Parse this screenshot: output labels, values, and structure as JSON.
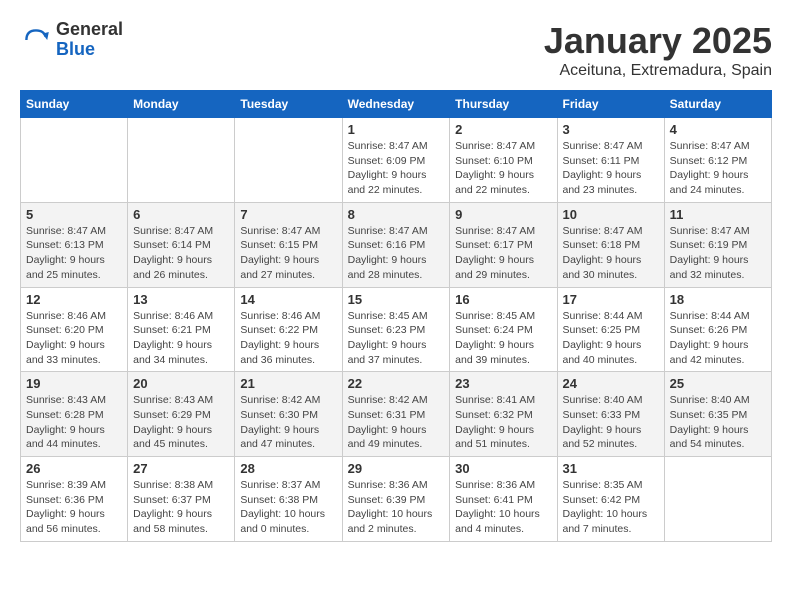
{
  "logo": {
    "general": "General",
    "blue": "Blue"
  },
  "title": {
    "month": "January 2025",
    "location": "Aceituna, Extremadura, Spain"
  },
  "weekdays": [
    "Sunday",
    "Monday",
    "Tuesday",
    "Wednesday",
    "Thursday",
    "Friday",
    "Saturday"
  ],
  "weeks": [
    [
      {
        "day": "",
        "sunrise": "",
        "sunset": "",
        "daylight": ""
      },
      {
        "day": "",
        "sunrise": "",
        "sunset": "",
        "daylight": ""
      },
      {
        "day": "",
        "sunrise": "",
        "sunset": "",
        "daylight": ""
      },
      {
        "day": "1",
        "sunrise": "Sunrise: 8:47 AM",
        "sunset": "Sunset: 6:09 PM",
        "daylight": "Daylight: 9 hours and 22 minutes."
      },
      {
        "day": "2",
        "sunrise": "Sunrise: 8:47 AM",
        "sunset": "Sunset: 6:10 PM",
        "daylight": "Daylight: 9 hours and 22 minutes."
      },
      {
        "day": "3",
        "sunrise": "Sunrise: 8:47 AM",
        "sunset": "Sunset: 6:11 PM",
        "daylight": "Daylight: 9 hours and 23 minutes."
      },
      {
        "day": "4",
        "sunrise": "Sunrise: 8:47 AM",
        "sunset": "Sunset: 6:12 PM",
        "daylight": "Daylight: 9 hours and 24 minutes."
      }
    ],
    [
      {
        "day": "5",
        "sunrise": "Sunrise: 8:47 AM",
        "sunset": "Sunset: 6:13 PM",
        "daylight": "Daylight: 9 hours and 25 minutes."
      },
      {
        "day": "6",
        "sunrise": "Sunrise: 8:47 AM",
        "sunset": "Sunset: 6:14 PM",
        "daylight": "Daylight: 9 hours and 26 minutes."
      },
      {
        "day": "7",
        "sunrise": "Sunrise: 8:47 AM",
        "sunset": "Sunset: 6:15 PM",
        "daylight": "Daylight: 9 hours and 27 minutes."
      },
      {
        "day": "8",
        "sunrise": "Sunrise: 8:47 AM",
        "sunset": "Sunset: 6:16 PM",
        "daylight": "Daylight: 9 hours and 28 minutes."
      },
      {
        "day": "9",
        "sunrise": "Sunrise: 8:47 AM",
        "sunset": "Sunset: 6:17 PM",
        "daylight": "Daylight: 9 hours and 29 minutes."
      },
      {
        "day": "10",
        "sunrise": "Sunrise: 8:47 AM",
        "sunset": "Sunset: 6:18 PM",
        "daylight": "Daylight: 9 hours and 30 minutes."
      },
      {
        "day": "11",
        "sunrise": "Sunrise: 8:47 AM",
        "sunset": "Sunset: 6:19 PM",
        "daylight": "Daylight: 9 hours and 32 minutes."
      }
    ],
    [
      {
        "day": "12",
        "sunrise": "Sunrise: 8:46 AM",
        "sunset": "Sunset: 6:20 PM",
        "daylight": "Daylight: 9 hours and 33 minutes."
      },
      {
        "day": "13",
        "sunrise": "Sunrise: 8:46 AM",
        "sunset": "Sunset: 6:21 PM",
        "daylight": "Daylight: 9 hours and 34 minutes."
      },
      {
        "day": "14",
        "sunrise": "Sunrise: 8:46 AM",
        "sunset": "Sunset: 6:22 PM",
        "daylight": "Daylight: 9 hours and 36 minutes."
      },
      {
        "day": "15",
        "sunrise": "Sunrise: 8:45 AM",
        "sunset": "Sunset: 6:23 PM",
        "daylight": "Daylight: 9 hours and 37 minutes."
      },
      {
        "day": "16",
        "sunrise": "Sunrise: 8:45 AM",
        "sunset": "Sunset: 6:24 PM",
        "daylight": "Daylight: 9 hours and 39 minutes."
      },
      {
        "day": "17",
        "sunrise": "Sunrise: 8:44 AM",
        "sunset": "Sunset: 6:25 PM",
        "daylight": "Daylight: 9 hours and 40 minutes."
      },
      {
        "day": "18",
        "sunrise": "Sunrise: 8:44 AM",
        "sunset": "Sunset: 6:26 PM",
        "daylight": "Daylight: 9 hours and 42 minutes."
      }
    ],
    [
      {
        "day": "19",
        "sunrise": "Sunrise: 8:43 AM",
        "sunset": "Sunset: 6:28 PM",
        "daylight": "Daylight: 9 hours and 44 minutes."
      },
      {
        "day": "20",
        "sunrise": "Sunrise: 8:43 AM",
        "sunset": "Sunset: 6:29 PM",
        "daylight": "Daylight: 9 hours and 45 minutes."
      },
      {
        "day": "21",
        "sunrise": "Sunrise: 8:42 AM",
        "sunset": "Sunset: 6:30 PM",
        "daylight": "Daylight: 9 hours and 47 minutes."
      },
      {
        "day": "22",
        "sunrise": "Sunrise: 8:42 AM",
        "sunset": "Sunset: 6:31 PM",
        "daylight": "Daylight: 9 hours and 49 minutes."
      },
      {
        "day": "23",
        "sunrise": "Sunrise: 8:41 AM",
        "sunset": "Sunset: 6:32 PM",
        "daylight": "Daylight: 9 hours and 51 minutes."
      },
      {
        "day": "24",
        "sunrise": "Sunrise: 8:40 AM",
        "sunset": "Sunset: 6:33 PM",
        "daylight": "Daylight: 9 hours and 52 minutes."
      },
      {
        "day": "25",
        "sunrise": "Sunrise: 8:40 AM",
        "sunset": "Sunset: 6:35 PM",
        "daylight": "Daylight: 9 hours and 54 minutes."
      }
    ],
    [
      {
        "day": "26",
        "sunrise": "Sunrise: 8:39 AM",
        "sunset": "Sunset: 6:36 PM",
        "daylight": "Daylight: 9 hours and 56 minutes."
      },
      {
        "day": "27",
        "sunrise": "Sunrise: 8:38 AM",
        "sunset": "Sunset: 6:37 PM",
        "daylight": "Daylight: 9 hours and 58 minutes."
      },
      {
        "day": "28",
        "sunrise": "Sunrise: 8:37 AM",
        "sunset": "Sunset: 6:38 PM",
        "daylight": "Daylight: 10 hours and 0 minutes."
      },
      {
        "day": "29",
        "sunrise": "Sunrise: 8:36 AM",
        "sunset": "Sunset: 6:39 PM",
        "daylight": "Daylight: 10 hours and 2 minutes."
      },
      {
        "day": "30",
        "sunrise": "Sunrise: 8:36 AM",
        "sunset": "Sunset: 6:41 PM",
        "daylight": "Daylight: 10 hours and 4 minutes."
      },
      {
        "day": "31",
        "sunrise": "Sunrise: 8:35 AM",
        "sunset": "Sunset: 6:42 PM",
        "daylight": "Daylight: 10 hours and 7 minutes."
      },
      {
        "day": "",
        "sunrise": "",
        "sunset": "",
        "daylight": ""
      }
    ]
  ]
}
